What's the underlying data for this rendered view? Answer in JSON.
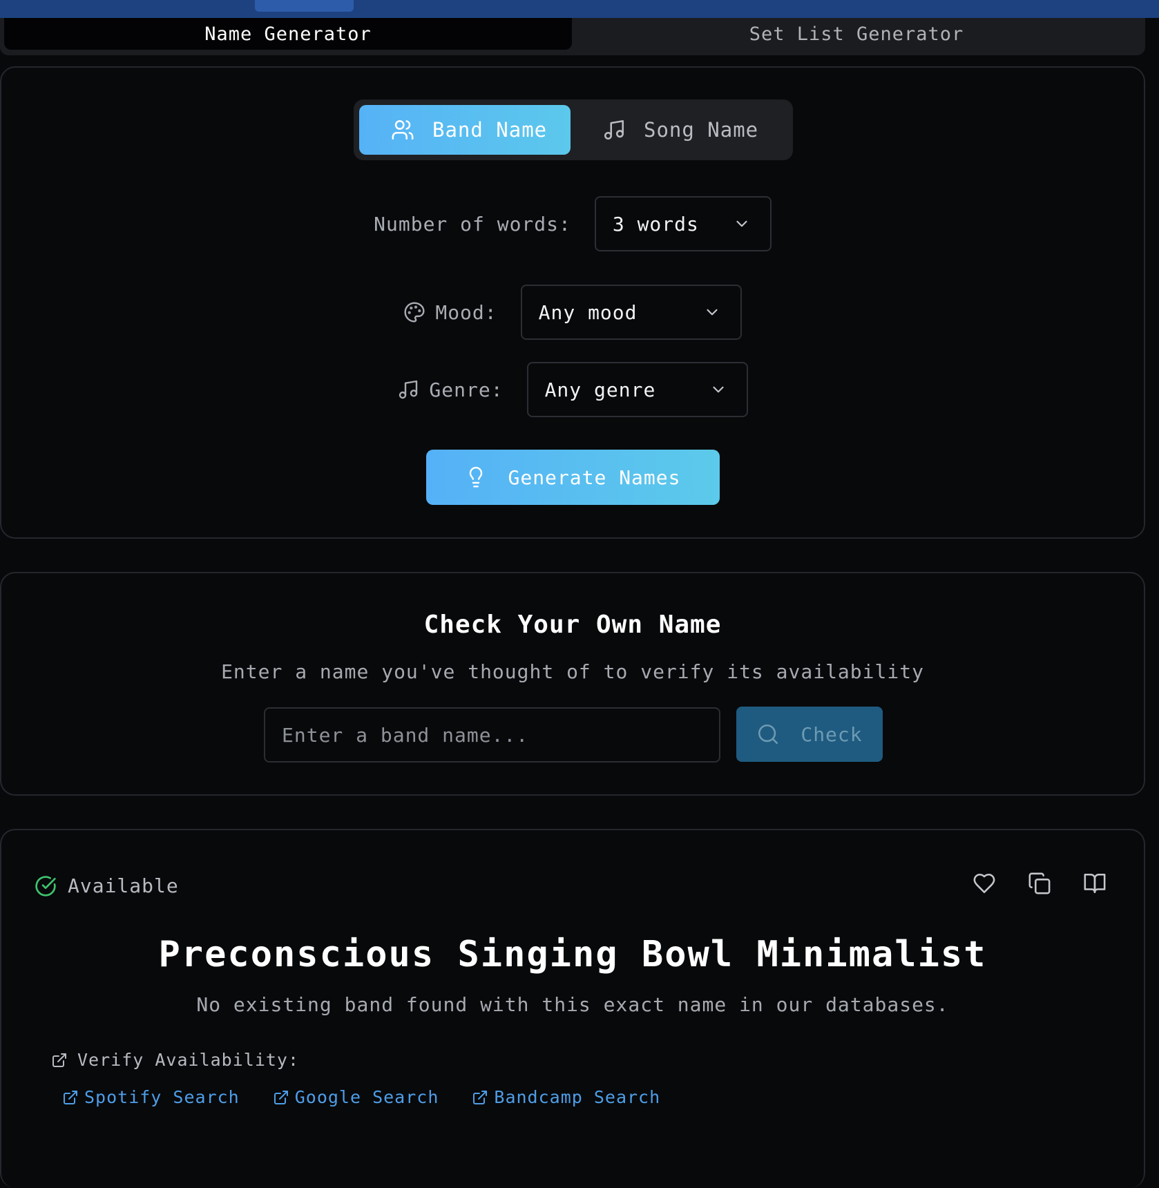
{
  "main_tabs": {
    "name_generator": "Name Generator",
    "set_list_generator": "Set List Generator"
  },
  "generator": {
    "type_toggle": {
      "band_name": "Band Name",
      "song_name": "Song Name"
    },
    "words": {
      "label": "Number of words:",
      "value": "3 words"
    },
    "mood": {
      "label": "Mood:",
      "value": "Any mood"
    },
    "genre": {
      "label": "Genre:",
      "value": "Any genre"
    },
    "generate_label": "Generate Names"
  },
  "check": {
    "title": "Check Your Own Name",
    "subtitle": "Enter a name you've thought of to verify its availability",
    "input_placeholder": "Enter a band name...",
    "button_label": "Check"
  },
  "result": {
    "status": "Available",
    "name": "Preconscious Singing Bowl Minimalist",
    "description": "No existing band found with this exact name in our databases.",
    "verify_title": "Verify Availability:",
    "links": [
      "Spotify Search",
      "Google Search",
      "Bandcamp Search"
    ]
  },
  "icons": {
    "band": "users-icon",
    "song": "music-note-icon",
    "mood": "palette-icon",
    "genre": "music-note-icon",
    "generate": "lightbulb-icon",
    "check": "search-icon",
    "status": "check-circle-icon",
    "favorite": "heart-icon",
    "copy": "copy-icon",
    "details": "book-open-icon",
    "external": "external-link-icon"
  },
  "colors": {
    "accent_gradient_start": "#56b2f6",
    "accent_gradient_end": "#5cc8ec",
    "available": "#3fc46d",
    "link": "#4e9ee8"
  }
}
